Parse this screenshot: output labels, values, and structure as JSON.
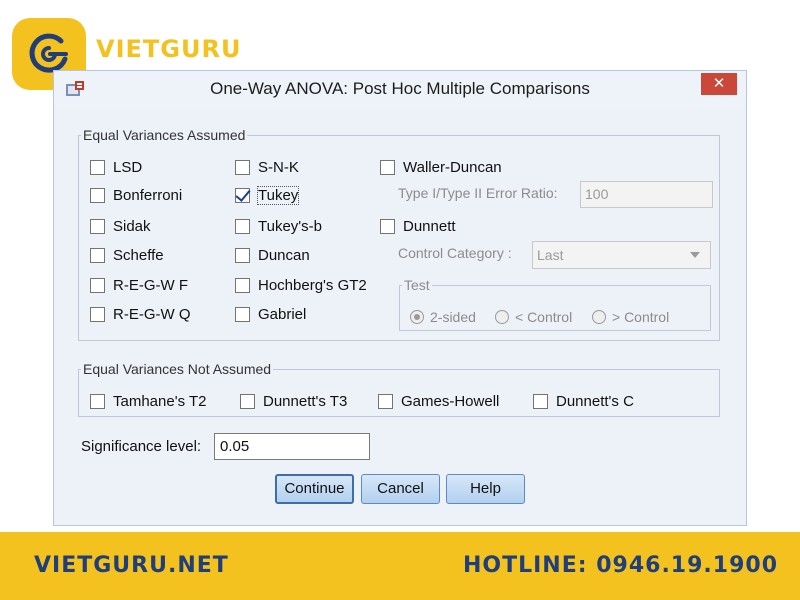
{
  "brand": {
    "name": "VIETGURU",
    "logo_color": "#f4c21f",
    "text_color": "#1f3e7a"
  },
  "dialog": {
    "title": "One-Way ANOVA: Post Hoc Multiple Comparisons",
    "close_label": "✕",
    "equal_assumed": {
      "legend": "Equal Variances Assumed",
      "options": [
        {
          "label": "LSD",
          "checked": false
        },
        {
          "label": "Bonferroni",
          "checked": false
        },
        {
          "label": "Sidak",
          "checked": false
        },
        {
          "label": "Scheffe",
          "checked": false
        },
        {
          "label": "R-E-G-W F",
          "checked": false
        },
        {
          "label": "R-E-G-W Q",
          "checked": false
        },
        {
          "label": "S-N-K",
          "checked": false
        },
        {
          "label": "Tukey",
          "checked": true
        },
        {
          "label": "Tukey's-b",
          "checked": false
        },
        {
          "label": "Duncan",
          "checked": false
        },
        {
          "label": "Hochberg's GT2",
          "checked": false
        },
        {
          "label": "Gabriel",
          "checked": false
        },
        {
          "label": "Waller-Duncan",
          "checked": false
        },
        {
          "label": "Dunnett",
          "checked": false
        }
      ],
      "error_ratio_label": "Type I/Type II Error Ratio:",
      "error_ratio_value": "100",
      "control_category_label": "Control Category :",
      "control_category_value": "Last",
      "test": {
        "legend": "Test",
        "options": [
          {
            "label": "2-sided",
            "selected": true
          },
          {
            "label": "< Control",
            "selected": false
          },
          {
            "label": "> Control",
            "selected": false
          }
        ]
      }
    },
    "equal_not_assumed": {
      "legend": "Equal Variances Not Assumed",
      "options": [
        {
          "label": "Tamhane's T2",
          "checked": false
        },
        {
          "label": "Dunnett's T3",
          "checked": false
        },
        {
          "label": "Games-Howell",
          "checked": false
        },
        {
          "label": "Dunnett's C",
          "checked": false
        }
      ]
    },
    "significance": {
      "label": "Significance level:",
      "value": "0.05"
    },
    "buttons": {
      "continue": "Continue",
      "cancel": "Cancel",
      "help": "Help"
    }
  },
  "footer": {
    "website": "VIETGURU.NET",
    "hotline": "HOTLINE: 0946.19.1900"
  }
}
